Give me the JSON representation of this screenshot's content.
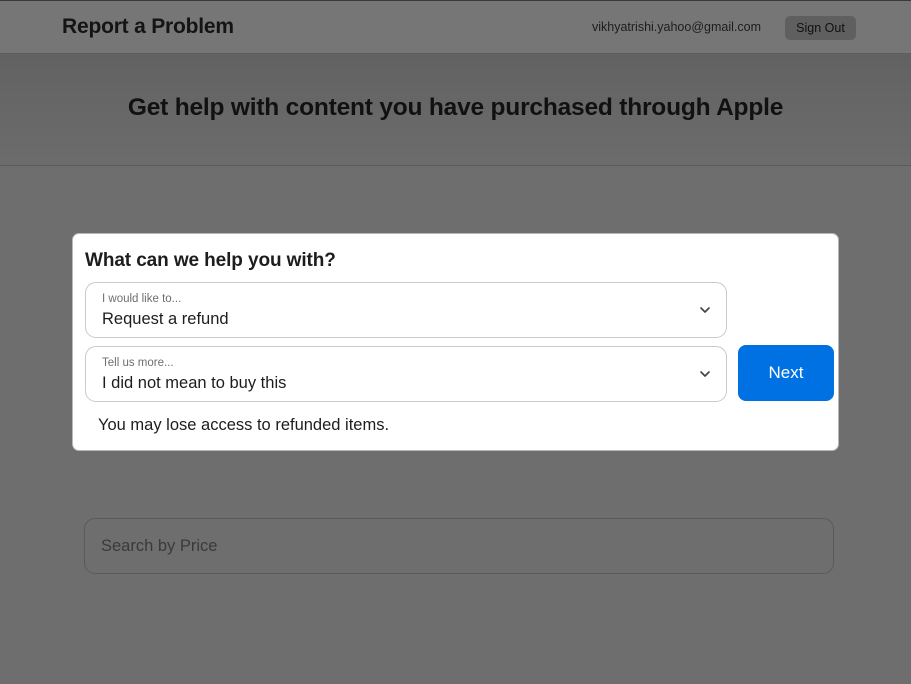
{
  "header": {
    "title": "Report a Problem",
    "user_email": "vikhyatrishi.yahoo@gmail.com",
    "sign_out_label": "Sign Out"
  },
  "hero": {
    "title": "Get help with content you have purchased through Apple"
  },
  "help_card": {
    "heading": "What can we help you with?",
    "primary_select": {
      "label": "I would like to...",
      "value": "Request a refund"
    },
    "secondary_select": {
      "label": "Tell us more...",
      "value": "I did not mean to buy this"
    },
    "next_label": "Next",
    "note": "You may lose access to refunded items."
  },
  "search": {
    "placeholder": "Search by Price"
  },
  "icons": {
    "select_chevron": "chevron-down-icon"
  },
  "colors": {
    "accent": "#0071e3",
    "overlay": "#6e6e6e",
    "card": "#ffffff"
  }
}
